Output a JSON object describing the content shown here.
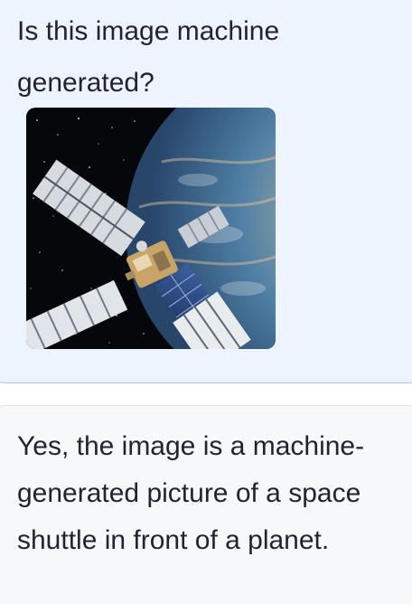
{
  "conversation": {
    "user_message": {
      "text": "Is this image machine generated?",
      "attached_image_subject": "satellite orbiting a planet"
    },
    "assistant_message": {
      "text": "Yes, the image is a machine-generated picture of a space shuttle in front of a planet."
    }
  },
  "colors": {
    "user_bubble_bg": "#eef4fd",
    "user_bubble_border": "#a9cbe6",
    "assistant_bubble_bg": "#f7f8fa",
    "text": "#1f2430"
  }
}
